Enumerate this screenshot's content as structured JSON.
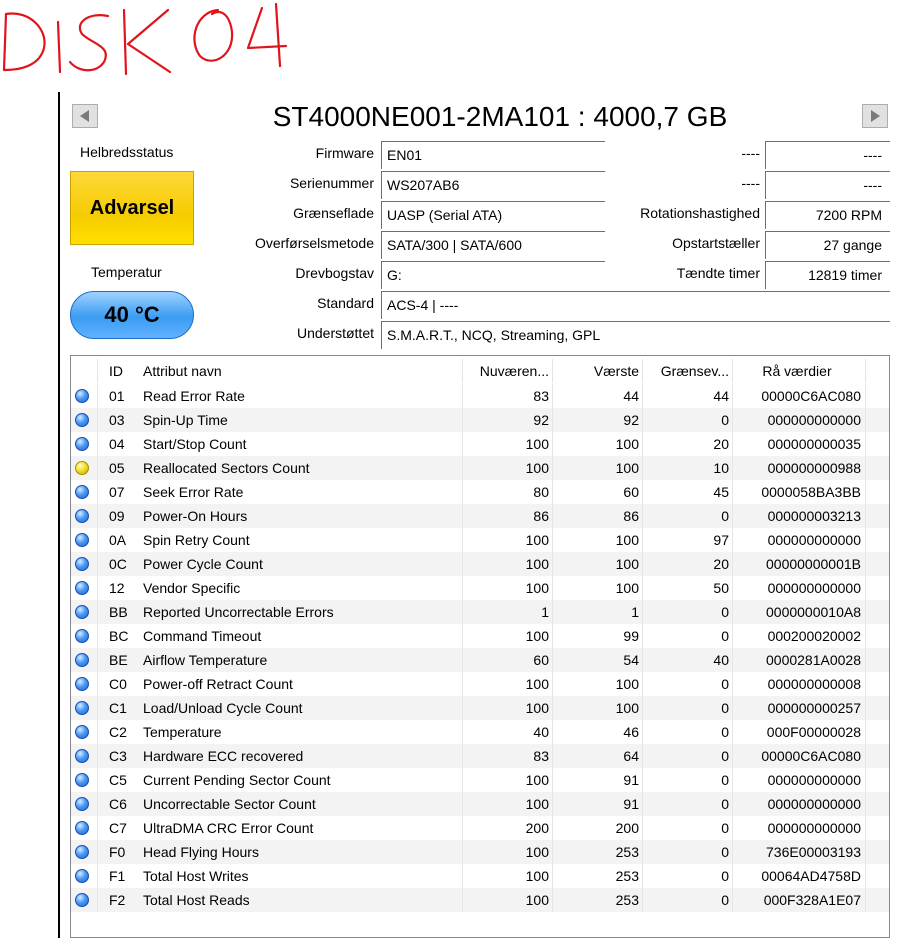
{
  "annotation": {
    "text": "DISK 04"
  },
  "header": {
    "title": "ST4000NE001-2MA101 : 4000,7 GB"
  },
  "health": {
    "label": "Helbredsstatus",
    "status": "Advarsel",
    "color": "#f5cc00"
  },
  "temperature": {
    "label": "Temperatur",
    "value": "40 °C",
    "color": "#3a9cf2"
  },
  "info": {
    "firmware": {
      "label": "Firmware",
      "value": "EN01"
    },
    "serial": {
      "label": "Serienummer",
      "value": "WS207AB6"
    },
    "interface": {
      "label": "Grænseflade",
      "value": "UASP (Serial ATA)"
    },
    "transfer": {
      "label": "Overførselsmetode",
      "value": "SATA/300 | SATA/600"
    },
    "drive_letter": {
      "label": "Drevbogstav",
      "value": "G:"
    },
    "standard": {
      "label": "Standard",
      "value": "ACS-4 | ----"
    },
    "supported": {
      "label": "Understøttet",
      "value": "S.M.A.R.T., NCQ, Streaming, GPL"
    }
  },
  "info_right": {
    "row1": {
      "label": "----",
      "value": "----"
    },
    "row2": {
      "label": "----",
      "value": "----"
    },
    "rotation": {
      "label": "Rotationshastighed",
      "value": "7200 RPM"
    },
    "power_count": {
      "label": "Opstartstæller",
      "value": "27 gange"
    },
    "power_hours": {
      "label": "Tændte timer",
      "value": "12819 timer"
    }
  },
  "table": {
    "columns": [
      "ID",
      "Attribut navn",
      "Nuværen...",
      "Værste",
      "Grænsev...",
      "Rå værdier"
    ],
    "rows": [
      {
        "status": "good",
        "id": "01",
        "name": "Read Error Rate",
        "current": "83",
        "worst": "44",
        "threshold": "44",
        "raw": "00000C6AC080"
      },
      {
        "status": "good",
        "id": "03",
        "name": "Spin-Up Time",
        "current": "92",
        "worst": "92",
        "threshold": "0",
        "raw": "000000000000"
      },
      {
        "status": "good",
        "id": "04",
        "name": "Start/Stop Count",
        "current": "100",
        "worst": "100",
        "threshold": "20",
        "raw": "000000000035"
      },
      {
        "status": "warn",
        "id": "05",
        "name": "Reallocated Sectors Count",
        "current": "100",
        "worst": "100",
        "threshold": "10",
        "raw": "000000000988"
      },
      {
        "status": "good",
        "id": "07",
        "name": "Seek Error Rate",
        "current": "80",
        "worst": "60",
        "threshold": "45",
        "raw": "0000058BA3BB"
      },
      {
        "status": "good",
        "id": "09",
        "name": "Power-On Hours",
        "current": "86",
        "worst": "86",
        "threshold": "0",
        "raw": "000000003213"
      },
      {
        "status": "good",
        "id": "0A",
        "name": "Spin Retry Count",
        "current": "100",
        "worst": "100",
        "threshold": "97",
        "raw": "000000000000"
      },
      {
        "status": "good",
        "id": "0C",
        "name": "Power Cycle Count",
        "current": "100",
        "worst": "100",
        "threshold": "20",
        "raw": "00000000001B"
      },
      {
        "status": "good",
        "id": "12",
        "name": "Vendor Specific",
        "current": "100",
        "worst": "100",
        "threshold": "50",
        "raw": "000000000000"
      },
      {
        "status": "good",
        "id": "BB",
        "name": "Reported Uncorrectable Errors",
        "current": "1",
        "worst": "1",
        "threshold": "0",
        "raw": "0000000010A8"
      },
      {
        "status": "good",
        "id": "BC",
        "name": "Command Timeout",
        "current": "100",
        "worst": "99",
        "threshold": "0",
        "raw": "000200020002"
      },
      {
        "status": "good",
        "id": "BE",
        "name": "Airflow Temperature",
        "current": "60",
        "worst": "54",
        "threshold": "40",
        "raw": "0000281A0028"
      },
      {
        "status": "good",
        "id": "C0",
        "name": "Power-off Retract Count",
        "current": "100",
        "worst": "100",
        "threshold": "0",
        "raw": "000000000008"
      },
      {
        "status": "good",
        "id": "C1",
        "name": "Load/Unload Cycle Count",
        "current": "100",
        "worst": "100",
        "threshold": "0",
        "raw": "000000000257"
      },
      {
        "status": "good",
        "id": "C2",
        "name": "Temperature",
        "current": "40",
        "worst": "46",
        "threshold": "0",
        "raw": "000F00000028"
      },
      {
        "status": "good",
        "id": "C3",
        "name": "Hardware ECC recovered",
        "current": "83",
        "worst": "64",
        "threshold": "0",
        "raw": "00000C6AC080"
      },
      {
        "status": "good",
        "id": "C5",
        "name": "Current Pending Sector Count",
        "current": "100",
        "worst": "91",
        "threshold": "0",
        "raw": "000000000000"
      },
      {
        "status": "good",
        "id": "C6",
        "name": "Uncorrectable Sector Count",
        "current": "100",
        "worst": "91",
        "threshold": "0",
        "raw": "000000000000"
      },
      {
        "status": "good",
        "id": "C7",
        "name": "UltraDMA CRC Error Count",
        "current": "200",
        "worst": "200",
        "threshold": "0",
        "raw": "000000000000"
      },
      {
        "status": "good",
        "id": "F0",
        "name": "Head Flying Hours",
        "current": "100",
        "worst": "253",
        "threshold": "0",
        "raw": "736E00003193"
      },
      {
        "status": "good",
        "id": "F1",
        "name": "Total Host Writes",
        "current": "100",
        "worst": "253",
        "threshold": "0",
        "raw": "00064AD4758D"
      },
      {
        "status": "good",
        "id": "F2",
        "name": "Total Host Reads",
        "current": "100",
        "worst": "253",
        "threshold": "0",
        "raw": "000F328A1E07"
      }
    ]
  }
}
